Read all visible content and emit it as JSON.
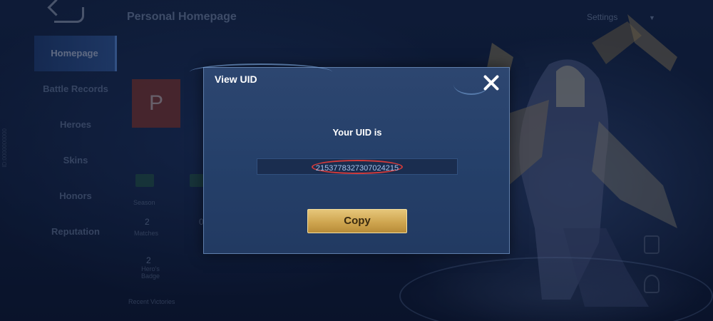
{
  "header": {
    "title": "Personal Homepage",
    "settings_label": "Settings"
  },
  "sidebar": {
    "vertical_text": "ID:0000000000",
    "items": [
      {
        "label": "Homepage"
      },
      {
        "label": "Battle Records"
      },
      {
        "label": "Heroes"
      },
      {
        "label": "Skins"
      },
      {
        "label": "Honors"
      },
      {
        "label": "Reputation"
      }
    ]
  },
  "profile": {
    "avatar_letter": "P",
    "stats": {
      "season_label": "Season",
      "matches_value": "2",
      "matches_label": "Matches",
      "matches2_value": "0",
      "heros_badge_value": "2",
      "heros_badge_label": "Hero's Badge",
      "recent_label": "Recent Victories"
    }
  },
  "dialog": {
    "title": "View UID",
    "uid_label": "Your UID is",
    "uid_value": "2153778327307024215",
    "copy_label": "Copy"
  },
  "colors": {
    "accent": "#6aa5ff",
    "dialog_bg": "#2d4670",
    "copy_button": "#cfa650",
    "highlight": "#d23a3a"
  }
}
